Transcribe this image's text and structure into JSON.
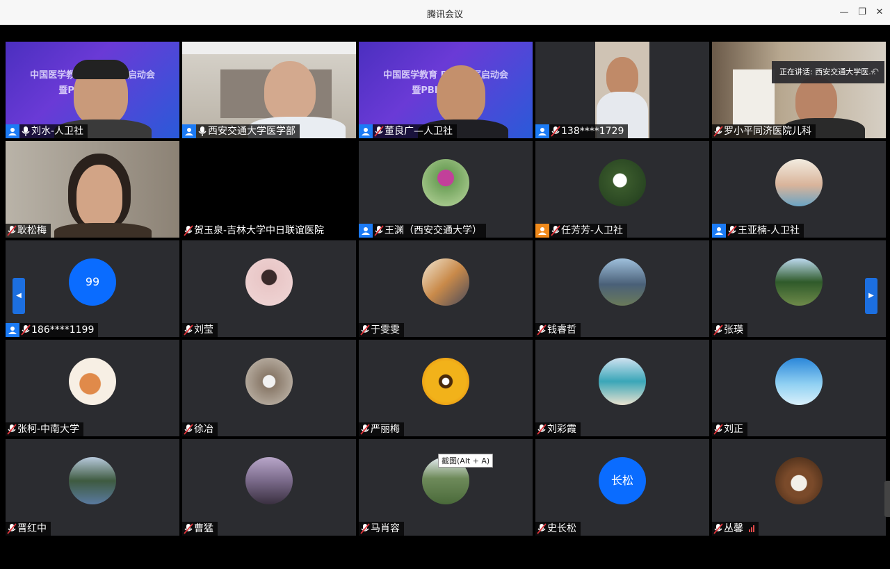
{
  "window": {
    "title": "腾讯会议",
    "minimize": "—",
    "restore": "❐",
    "close": "✕"
  },
  "speaking_banner": {
    "text": "正在讲话: 西安交通大学医...",
    "undo": "↶"
  },
  "tooltip": "截图(Alt + A)",
  "pager": {
    "prev": "◀",
    "next": "▶"
  },
  "banner_text": {
    "line1": "中国医学教育 PBL 编写启动会",
    "line2": "暨PBL案例 划会"
  },
  "colors": {
    "accent": "#1c7bf5",
    "avatar_bg": "#0a6cff",
    "active_border": "#2dbf5c"
  },
  "participants": [
    {
      "name": "刘水-人卫社",
      "user_icon": true,
      "mic": "on"
    },
    {
      "name": "西安交通大学医学部",
      "user_icon": true,
      "mic": "on"
    },
    {
      "name": "董良广—人卫社",
      "user_icon": true,
      "mic": "muted"
    },
    {
      "name": "138****1729",
      "user_icon": true,
      "mic": "muted"
    },
    {
      "name": "罗小平同济医院儿科",
      "user_icon": false,
      "mic": "muted"
    },
    {
      "name": "耿松梅",
      "user_icon": false,
      "mic": "muted"
    },
    {
      "name": "贺玉泉-吉林大学中日联谊医院",
      "user_icon": false,
      "mic": "muted"
    },
    {
      "name": "王渊（西安交通大学）",
      "user_icon": true,
      "mic": "muted"
    },
    {
      "name": "任芳芳-人卫社",
      "user_icon": true,
      "mic": "muted"
    },
    {
      "name": "王亚楠-人卫社",
      "user_icon": true,
      "mic": "muted"
    },
    {
      "name": "186****1199",
      "user_icon": true,
      "mic": "muted",
      "avatar_text": "99"
    },
    {
      "name": "刘莹",
      "user_icon": false,
      "mic": "muted"
    },
    {
      "name": "于雯雯",
      "user_icon": false,
      "mic": "muted"
    },
    {
      "name": "钱睿哲",
      "user_icon": false,
      "mic": "muted"
    },
    {
      "name": "张瑛",
      "user_icon": false,
      "mic": "muted"
    },
    {
      "name": "张柯-中南大学",
      "user_icon": false,
      "mic": "muted"
    },
    {
      "name": "徐冶",
      "user_icon": false,
      "mic": "muted"
    },
    {
      "name": "严丽梅",
      "user_icon": false,
      "mic": "muted"
    },
    {
      "name": "刘彩霞",
      "user_icon": false,
      "mic": "muted"
    },
    {
      "name": "刘正",
      "user_icon": false,
      "mic": "muted"
    },
    {
      "name": "晋红中",
      "user_icon": false,
      "mic": "muted"
    },
    {
      "name": "曹猛",
      "user_icon": false,
      "mic": "muted"
    },
    {
      "name": "马肖容",
      "user_icon": false,
      "mic": "muted"
    },
    {
      "name": "史长松",
      "user_icon": false,
      "mic": "muted",
      "avatar_text": "长松"
    },
    {
      "name": "丛馨",
      "user_icon": false,
      "mic": "muted"
    }
  ]
}
